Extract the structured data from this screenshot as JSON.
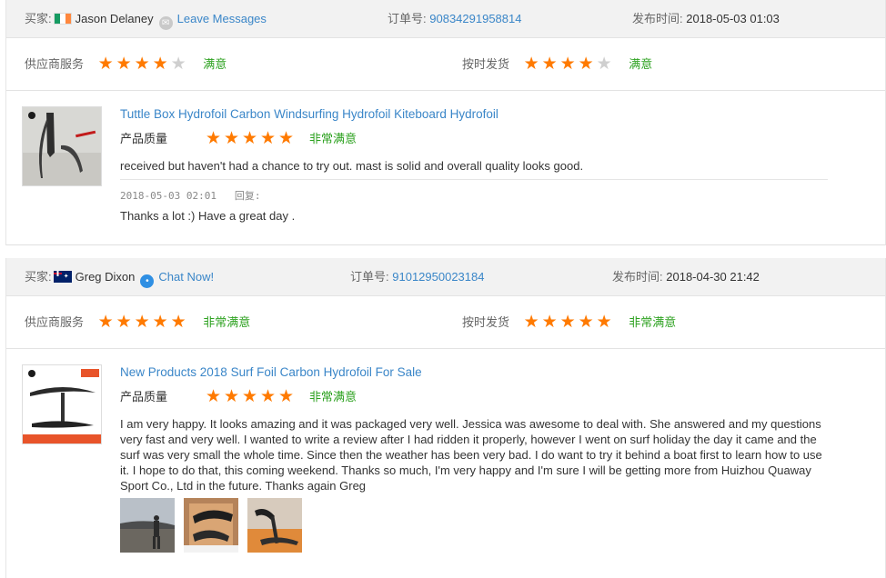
{
  "reviews": [
    {
      "buyer_label": "买家:",
      "buyer_name": "Jason Delaney",
      "contact_link": "Leave Messages",
      "order_label": "订单号:",
      "order_no": "90834291958814",
      "date_label": "发布时间:",
      "date": "2018-05-03 01:03",
      "supplier_label": "供应商服务",
      "supplier_stars": 4,
      "supplier_text": "满意",
      "shipping_label": "按时发货",
      "shipping_stars": 4,
      "shipping_text": "满意",
      "product_title": "Tuttle Box Hydrofoil Carbon Windsurfing Hydrofoil Kiteboard Hydrofoil",
      "quality_label": "产品质量",
      "quality_stars": 5,
      "quality_text": "非常满意",
      "comment": "received but haven't had a chance to try out. mast is solid and overall quality looks good.",
      "reply_time": "2018-05-03 02:01",
      "reply_label": "回复:",
      "reply_text": "Thanks a lot :) Have a great day ."
    },
    {
      "buyer_label": "买家:",
      "buyer_name": "Greg Dixon",
      "contact_link": "Chat Now!",
      "order_label": "订单号:",
      "order_no": "91012950023184",
      "date_label": "发布时间:",
      "date": "2018-04-30 21:42",
      "supplier_label": "供应商服务",
      "supplier_stars": 5,
      "supplier_text": "非常满意",
      "shipping_label": "按时发货",
      "shipping_stars": 5,
      "shipping_text": "非常满意",
      "product_title": "New Products 2018 Surf Foil Carbon Hydrofoil For Sale",
      "quality_label": "产品质量",
      "quality_stars": 5,
      "quality_text": "非常满意",
      "comment": "I am very happy. It looks amazing and it was packaged very well. Jessica was awesome to deal with. She answered and my questions very fast and very well. I wanted to write a review after I had ridden it properly, however I went on surf holiday the day it came and the surf was very small the whole time. Since then the weather has been very bad. I do want to try it behind a boat first to learn how to use it. I hope to do that, this coming weekend. Thanks so much, I'm very happy and I'm sure I will be getting more from Huizhou Quaway Sport Co., Ltd in the future. Thanks again Greg",
      "photos": [
        "beach-photo",
        "foil-box-photo",
        "foil-wing-photo"
      ]
    }
  ],
  "colors": {
    "star": "#ff7a00",
    "star_off": "#cfcfcf",
    "link": "#3a86c8",
    "satisfied": "#2ca11f",
    "header_bg": "#f2f2f2"
  },
  "icons": {
    "ie_flag": "ireland-flag-icon",
    "au_flag": "australia-flag-icon",
    "message": "message-icon",
    "chat": "chat-icon",
    "star": "star-icon"
  }
}
